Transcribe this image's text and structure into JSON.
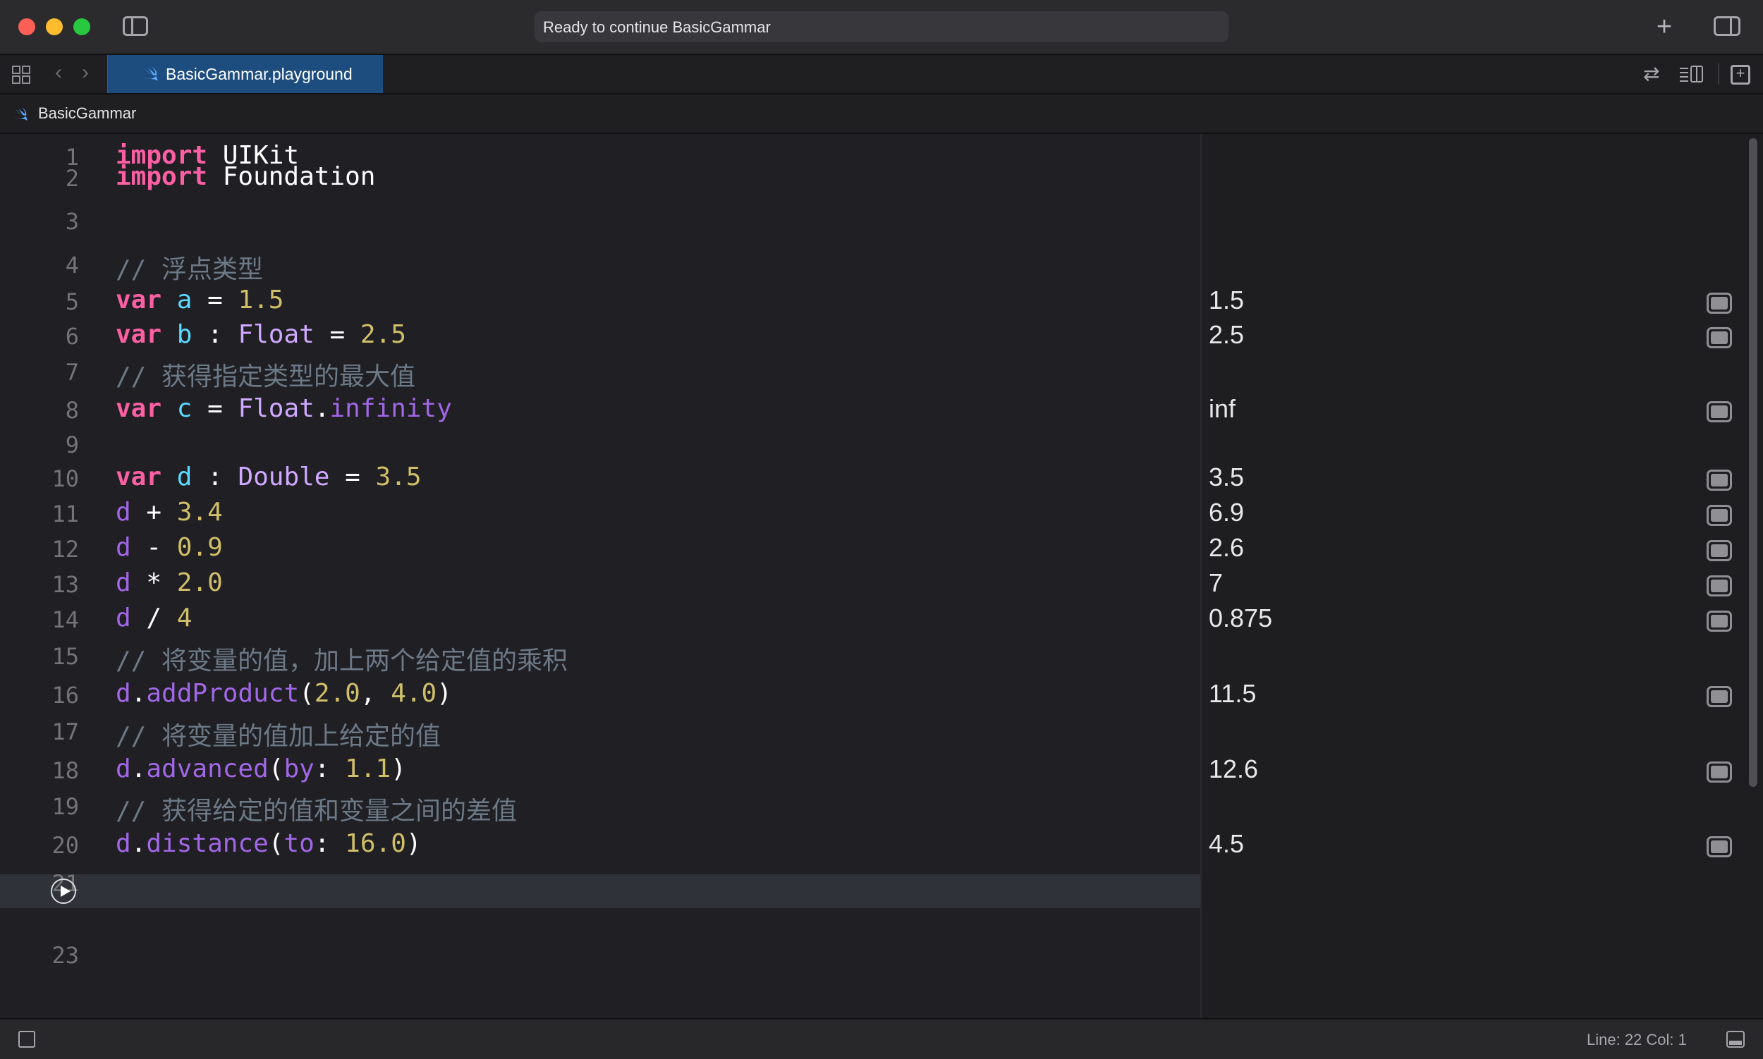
{
  "window": {
    "activity_text": "Ready to continue BasicGammar",
    "tab_title": "BasicGammar.playground",
    "breadcrumb": "BasicGammar"
  },
  "editor": {
    "lines": [
      {
        "n": "1",
        "tokens": [
          [
            "kw",
            "import"
          ],
          [
            "plain",
            " UIKit"
          ]
        ]
      },
      {
        "n": "2",
        "tokens": [
          [
            "kw",
            "import"
          ],
          [
            "plain",
            " Foundation"
          ]
        ]
      },
      {
        "n": "3",
        "tokens": []
      },
      {
        "n": "4",
        "tokens": [
          [
            "cmt",
            "// 浮点类型"
          ]
        ]
      },
      {
        "n": "5",
        "tokens": [
          [
            "kw",
            "var"
          ],
          [
            "plain",
            " "
          ],
          [
            "var",
            "a"
          ],
          [
            "plain",
            " = "
          ],
          [
            "num",
            "1.5"
          ]
        ]
      },
      {
        "n": "6",
        "tokens": [
          [
            "kw",
            "var"
          ],
          [
            "plain",
            " "
          ],
          [
            "var",
            "b"
          ],
          [
            "plain",
            " : "
          ],
          [
            "type",
            "Float"
          ],
          [
            "plain",
            " = "
          ],
          [
            "num",
            "2.5"
          ]
        ]
      },
      {
        "n": "7",
        "tokens": [
          [
            "cmt",
            "// 获得指定类型的最大值"
          ]
        ]
      },
      {
        "n": "8",
        "tokens": [
          [
            "kw",
            "var"
          ],
          [
            "plain",
            " "
          ],
          [
            "var",
            "c"
          ],
          [
            "plain",
            " = "
          ],
          [
            "type",
            "Float"
          ],
          [
            "plain",
            "."
          ],
          [
            "prop",
            "infinity"
          ]
        ]
      },
      {
        "n": "9",
        "tokens": []
      },
      {
        "n": "10",
        "tokens": [
          [
            "kw",
            "var"
          ],
          [
            "plain",
            " "
          ],
          [
            "var",
            "d"
          ],
          [
            "plain",
            " : "
          ],
          [
            "type",
            "Double"
          ],
          [
            "plain",
            " = "
          ],
          [
            "num",
            "3.5"
          ]
        ]
      },
      {
        "n": "11",
        "tokens": [
          [
            "prop",
            "d"
          ],
          [
            "plain",
            " + "
          ],
          [
            "num",
            "3.4"
          ]
        ]
      },
      {
        "n": "12",
        "tokens": [
          [
            "prop",
            "d"
          ],
          [
            "plain",
            " - "
          ],
          [
            "num",
            "0.9"
          ]
        ]
      },
      {
        "n": "13",
        "tokens": [
          [
            "prop",
            "d"
          ],
          [
            "plain",
            " * "
          ],
          [
            "num",
            "2.0"
          ]
        ]
      },
      {
        "n": "14",
        "tokens": [
          [
            "prop",
            "d"
          ],
          [
            "plain",
            " / "
          ],
          [
            "num",
            "4"
          ]
        ]
      },
      {
        "n": "15",
        "tokens": [
          [
            "cmt",
            "// 将变量的值，加上两个给定值的乘积"
          ]
        ]
      },
      {
        "n": "16",
        "tokens": [
          [
            "prop",
            "d"
          ],
          [
            "plain",
            "."
          ],
          [
            "prop",
            "addProduct"
          ],
          [
            "plain",
            "("
          ],
          [
            "num",
            "2.0"
          ],
          [
            "plain",
            ", "
          ],
          [
            "num",
            "4.0"
          ],
          [
            "plain",
            ")"
          ]
        ]
      },
      {
        "n": "17",
        "tokens": [
          [
            "cmt",
            "// 将变量的值加上给定的值"
          ]
        ]
      },
      {
        "n": "18",
        "tokens": [
          [
            "prop",
            "d"
          ],
          [
            "plain",
            "."
          ],
          [
            "prop",
            "advanced"
          ],
          [
            "plain",
            "("
          ],
          [
            "prop",
            "by"
          ],
          [
            "plain",
            ": "
          ],
          [
            "num",
            "1.1"
          ],
          [
            "plain",
            ")"
          ]
        ]
      },
      {
        "n": "19",
        "tokens": [
          [
            "cmt",
            "// 获得给定的值和变量之间的差值"
          ]
        ]
      },
      {
        "n": "20",
        "tokens": [
          [
            "prop",
            "d"
          ],
          [
            "plain",
            "."
          ],
          [
            "prop",
            "distance"
          ],
          [
            "plain",
            "("
          ],
          [
            "prop",
            "to"
          ],
          [
            "plain",
            ": "
          ],
          [
            "num",
            "16.0"
          ],
          [
            "plain",
            ")"
          ]
        ]
      },
      {
        "n": "21",
        "tokens": []
      },
      {
        "n": "22",
        "tokens": []
      },
      {
        "n": "23",
        "tokens": []
      }
    ],
    "active_line": "22"
  },
  "results": [
    {
      "line": "5",
      "value": "1.5"
    },
    {
      "line": "6",
      "value": "2.5"
    },
    {
      "line": "8",
      "value": "inf"
    },
    {
      "line": "10",
      "value": "3.5"
    },
    {
      "line": "11",
      "value": "6.9"
    },
    {
      "line": "12",
      "value": "2.6"
    },
    {
      "line": "13",
      "value": "7"
    },
    {
      "line": "14",
      "value": "0.875"
    },
    {
      "line": "16",
      "value": "11.5"
    },
    {
      "line": "18",
      "value": "12.6"
    },
    {
      "line": "20",
      "value": "4.5"
    }
  ],
  "status": {
    "position": "Line: 22  Col: 1"
  },
  "icons": {
    "close": "close-window-icon",
    "minimize": "minimize-window-icon",
    "zoom": "zoom-window-icon",
    "sidebar": "sidebar-toggle-icon",
    "add": "plus-icon",
    "inspector": "inspector-toggle-icon",
    "grid": "related-items-grid-icon",
    "back": "chevron-left-icon",
    "forward": "chevron-right-icon",
    "swift": "swift-icon",
    "play": "run-play-icon",
    "quicklook": "quick-look-icon"
  },
  "colors": {
    "keyword": "#fc5fa3",
    "number": "#d0bf69",
    "comment": "#6c7986",
    "type": "#d0a8ff",
    "property": "#a167e6",
    "variable": "#5dd8ff",
    "tab_active": "#1d4d7e"
  }
}
